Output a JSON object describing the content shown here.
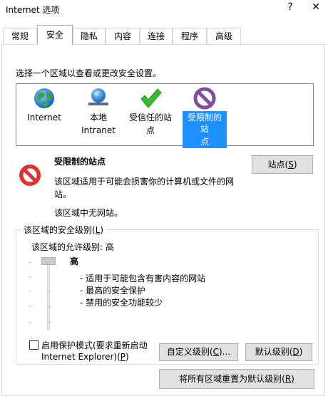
{
  "window": {
    "title": "Internet 选项",
    "help_label": "?",
    "close_label": "✕"
  },
  "tabs": [
    {
      "label": "常规"
    },
    {
      "label": "安全"
    },
    {
      "label": "隐私"
    },
    {
      "label": "内容"
    },
    {
      "label": "连接"
    },
    {
      "label": "程序"
    },
    {
      "label": "高级"
    }
  ],
  "active_tab": "安全",
  "zone_instruction": "选择一个区域以查看或更改安全设置。",
  "zones": [
    {
      "line1": "Internet",
      "line2": "",
      "icon": "globe-icon",
      "selected": false
    },
    {
      "line1": "本地",
      "line2": "Intranet",
      "icon": "intranet-globe-icon",
      "selected": false
    },
    {
      "line1": "受信任的站",
      "line2": "点",
      "icon": "checkmark-icon",
      "selected": false
    },
    {
      "line1": "受限制的站",
      "line2": "点",
      "icon": "restricted-icon",
      "selected": true
    }
  ],
  "selected_zone": {
    "name": "受限制的站点",
    "desc": "该区域适用于可能会损害你的计算机或文件的网站。",
    "empty_note": "该区域中无网站。"
  },
  "sites_button": {
    "text": "站点(",
    "key": "S",
    "end": ")"
  },
  "security_group": {
    "label_text": "该区域的安全级别(",
    "label_key": "L",
    "label_end": ")",
    "allowed_level": "该区域的允许级别: 高",
    "level_title": "高",
    "level_desc": [
      "- 适用于可能包含有害内容的网站",
      "- 最高的安全保护",
      "- 禁用的安全功能较少"
    ]
  },
  "protected_mode": {
    "line1": "启用保护模式(要求重新启动",
    "line2_text": "Internet Explorer)(",
    "line2_key": "P",
    "line2_end": ")",
    "checked": false
  },
  "custom_button": {
    "text": "自定义级别(",
    "key": "C",
    "end": ")..."
  },
  "default_button": {
    "text": "默认级别(",
    "key": "D",
    "end": ")"
  },
  "reset_button": {
    "text": "将所有区域重置为默认级别(",
    "key": "R",
    "end": ")"
  },
  "colors": {
    "selection": "#1e90ff",
    "button_bg": "#e1e1e1",
    "border": "#adadad"
  }
}
